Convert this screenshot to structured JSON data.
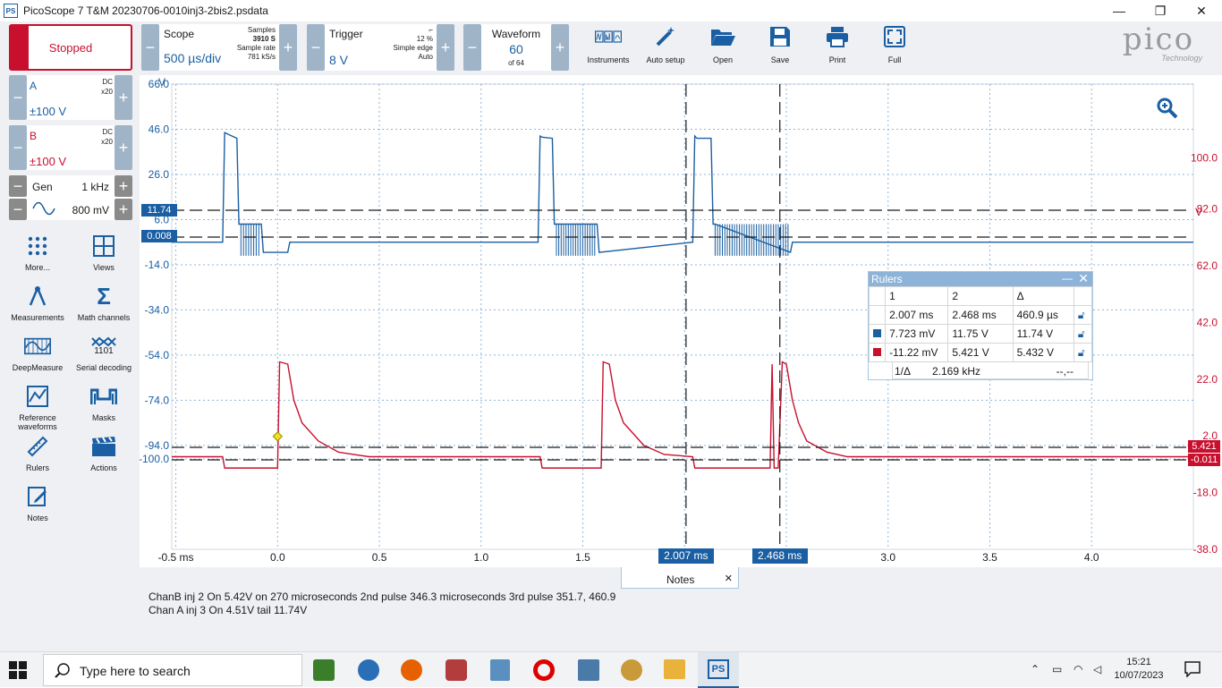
{
  "window": {
    "title": "PicoScope 7 T&M 20230706-0010inj3-2bis2.psdata",
    "app_icon": "PS",
    "minimize": "—",
    "maximize": "❐",
    "close": "✕"
  },
  "toolbar": {
    "run_state": "Stopped",
    "scope": {
      "label": "Scope",
      "timebase": "500 µs/div",
      "samples_label": "Samples",
      "samples": "3910 S",
      "rate_label": "Sample rate",
      "rate": "781 kS/s"
    },
    "trigger": {
      "label": "Trigger",
      "level": "8 V",
      "percent": "12 %",
      "mode": "Simple edge",
      "auto": "Auto"
    },
    "waveform": {
      "label": "Waveform",
      "number": "60",
      "of": "of 64"
    },
    "minus": "−",
    "plus": "+",
    "tools": [
      {
        "name": "instruments",
        "label": "Instruments"
      },
      {
        "name": "auto-setup",
        "label": "Auto setup"
      },
      {
        "name": "open",
        "label": "Open"
      },
      {
        "name": "save",
        "label": "Save"
      },
      {
        "name": "print",
        "label": "Print"
      },
      {
        "name": "full",
        "label": "Full"
      }
    ],
    "brand": "pico",
    "brand_sub": "Technology"
  },
  "channels": [
    {
      "id": "A",
      "coupling": "DC",
      "probe": "x20",
      "range": "±100 V",
      "color": "#1a5fa3"
    },
    {
      "id": "B",
      "coupling": "DC",
      "probe": "x20",
      "range": "±100 V",
      "color": "#c8102e"
    }
  ],
  "generator": {
    "label": "Gen",
    "freq": "1 kHz",
    "amp": "800 mV"
  },
  "side_buttons": [
    {
      "name": "more",
      "label": "More...",
      "icon": "grid-dots-icon"
    },
    {
      "name": "views",
      "label": "Views",
      "icon": "views-icon"
    },
    {
      "name": "measurements",
      "label": "Measurements",
      "icon": "caliper-icon"
    },
    {
      "name": "math-channels",
      "label": "Math channels",
      "icon": "sigma-icon"
    },
    {
      "name": "deepmeasure",
      "label": "DeepMeasure",
      "icon": "deepmeasure-icon"
    },
    {
      "name": "serial-decoding",
      "label": "Serial decoding",
      "icon": "serial-icon"
    },
    {
      "name": "reference-waveforms",
      "label": "Reference waveforms",
      "icon": "reference-icon"
    },
    {
      "name": "masks",
      "label": "Masks",
      "icon": "mask-icon"
    },
    {
      "name": "rulers",
      "label": "Rulers",
      "icon": "ruler-icon"
    },
    {
      "name": "actions",
      "label": "Actions",
      "icon": "clapper-icon"
    },
    {
      "name": "notes",
      "label": "Notes",
      "icon": "notes-icon"
    }
  ],
  "chart_data": {
    "type": "line",
    "x_unit": "ms",
    "xlim": [
      -0.52,
      4.5
    ],
    "x_ticks": [
      "-0.5 ms",
      "0.0",
      "0.5",
      "1.0",
      "1.5",
      "2.0",
      "2.5",
      "3.0",
      "3.5",
      "4.0"
    ],
    "y_left": {
      "unit": "V",
      "ylim": [
        -140,
        66
      ],
      "ticks": [
        "66.0",
        "46.0",
        "26.0",
        "6.0",
        "-14.0",
        "-34.0",
        "-54.0",
        "-74.0",
        "-94.0",
        "-100.0"
      ]
    },
    "y_right": {
      "unit": "V",
      "ylim": [
        -38,
        126
      ],
      "ticks": [
        "100.0",
        "82.0",
        "62.0",
        "42.0",
        "22.0",
        "2.0",
        "-18.0",
        "-38.0"
      ]
    },
    "series": [
      {
        "channel": "A",
        "color": "#1a5fa3",
        "x": [
          -0.52,
          -0.27,
          -0.26,
          -0.2,
          -0.19,
          -0.18,
          -0.08,
          -0.07,
          0.05,
          0.06,
          1.28,
          1.29,
          1.3,
          1.35,
          1.36,
          1.37,
          1.57,
          1.58,
          2.04,
          2.05,
          2.06,
          2.13,
          2.14,
          2.15,
          2.52,
          2.53,
          4.5
        ],
        "y": [
          0.0,
          0.0,
          48.5,
          46.0,
          8.0,
          8.0,
          8.0,
          -4.5,
          -4.5,
          0.0,
          0.0,
          47.0,
          46.5,
          46.0,
          8.0,
          8.0,
          8.0,
          -4.5,
          0.0,
          47.0,
          46.0,
          46.0,
          8.0,
          8.0,
          -4.5,
          0.0,
          0.0
        ]
      },
      {
        "channel": "B",
        "color": "#c8102e",
        "x": [
          -0.52,
          -0.27,
          -0.26,
          0.0,
          0.01,
          0.05,
          0.08,
          0.12,
          0.2,
          0.3,
          0.45,
          1.29,
          1.3,
          1.59,
          1.6,
          1.63,
          1.66,
          1.7,
          1.8,
          1.9,
          2.04,
          2.05,
          2.42,
          2.43,
          2.44,
          2.45,
          2.46,
          2.48,
          2.5,
          2.53,
          2.56,
          2.6,
          2.7,
          2.8,
          4.5
        ],
        "y": [
          5.0,
          5.0,
          0.0,
          0.0,
          47.0,
          46.0,
          30.0,
          20.0,
          12.0,
          7.0,
          5.0,
          5.0,
          0.0,
          0.0,
          47.0,
          46.0,
          30.0,
          20.0,
          10.0,
          6.0,
          5.0,
          0.0,
          0.0,
          46.0,
          0.0,
          0.0,
          0.0,
          47.0,
          46.0,
          30.0,
          20.0,
          12.0,
          7.0,
          5.0,
          5.0
        ]
      }
    ],
    "marker_a_left": "11.74",
    "marker_a_left_2": "0.008",
    "marker_b_right": "5.421",
    "marker_b_right_2": "-0.011",
    "ruler_times": [
      "2.007 ms",
      "2.468 ms"
    ],
    "ruler_t_values": [
      2.007,
      2.468
    ]
  },
  "rulers_window": {
    "title": "Rulers",
    "headers": [
      "",
      "1",
      "2",
      "Δ",
      ""
    ],
    "rows": [
      {
        "marker": "",
        "c1": "2.007 ms",
        "c2": "2.468 ms",
        "d": "460.9 µs"
      },
      {
        "marker": "#1a5fa3",
        "c1": "7.723 mV",
        "c2": "11.75 V",
        "d": "11.74 V"
      },
      {
        "marker": "#c8102e",
        "c1": "-11.22 mV",
        "c2": "5.421 V",
        "d": "5.432 V"
      }
    ],
    "inv_label": "1/Δ",
    "inv_value": "2.169 kHz",
    "inv_extra": "--,--"
  },
  "notes": {
    "tab": "Notes",
    "lines": [
      "ChanB inj 2  On 5.42V  on 270 microseconds 2nd pulse 346.3 microseconds 3rd pulse  351.7, 460.9",
      "Chan A inj 3 On 4.51V  tail  11.74V"
    ]
  },
  "taskbar": {
    "search_placeholder": "Type here to search",
    "time": "15:21",
    "date": "10/07/2023"
  }
}
